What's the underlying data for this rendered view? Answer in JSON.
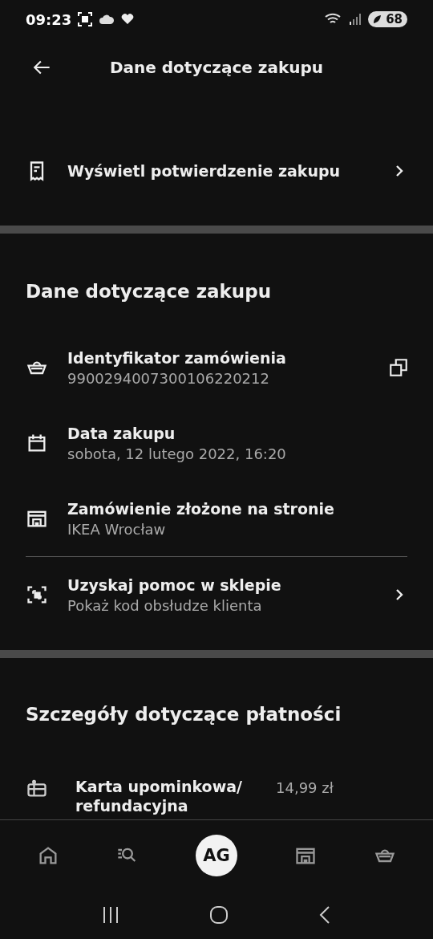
{
  "status_bar": {
    "time": "09:23",
    "battery": "68"
  },
  "header": {
    "title": "Dane dotyczące zakupu"
  },
  "manage_section": {
    "items": [
      {
        "kind": "receipt",
        "label": "Wyświetl potwierdzenie zakupu",
        "chevron": true,
        "copy": false,
        "divided": false
      }
    ]
  },
  "purchase_section": {
    "heading": "Dane dotyczące zakupu",
    "items": [
      {
        "kind": "basket",
        "label": "Identyfikator zamówienia",
        "value": "9900294007300106220212",
        "chevron": false,
        "copy": true,
        "divided": false
      },
      {
        "kind": "calendar",
        "label": "Data zakupu",
        "value": "sobota, 12 lutego 2022, 16:20",
        "chevron": false,
        "copy": false,
        "divided": false
      },
      {
        "kind": "store",
        "label": "Zamówienie złożone na stronie",
        "value": "IKEA Wrocław",
        "chevron": false,
        "copy": false,
        "divided": false
      },
      {
        "kind": "code",
        "label": "Uzyskaj pomoc w sklepie",
        "value": "Pokaż kod obsłudze klienta",
        "chevron": true,
        "copy": false,
        "divided": true
      }
    ]
  },
  "payment_section": {
    "heading": "Szczegóły dotyczące płatności",
    "items": [
      {
        "kind": "gift",
        "label": "Karta upominkowa/ refundacyjna",
        "amount": "14,99 zł"
      }
    ]
  },
  "bottom_nav": [
    {
      "kind": "home",
      "selected": false
    },
    {
      "kind": "search",
      "selected": false
    },
    {
      "kind": "profile",
      "label": "AG",
      "selected": true
    },
    {
      "kind": "store",
      "selected": false
    },
    {
      "kind": "basket",
      "selected": false
    }
  ]
}
